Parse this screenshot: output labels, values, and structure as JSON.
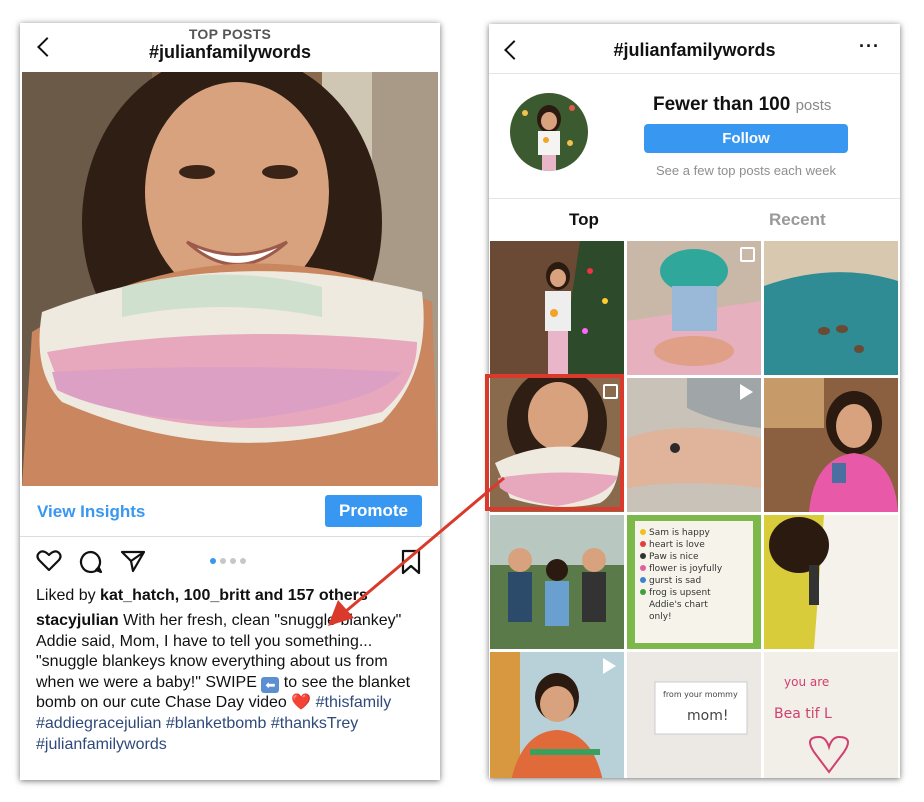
{
  "left": {
    "section_label": "TOP POSTS",
    "hashtag": "#julianfamilywords",
    "insights_label": "View Insights",
    "promote_label": "Promote",
    "likes_prefix": "Liked by",
    "liker1": "kat_hatch",
    "liker_sep": ",",
    "liker2": "100_britt",
    "likes_and": "and",
    "likes_count": "157 others",
    "caption_user": "stacyjulian",
    "caption_text1": "With her fresh, clean \"snuggle blankey\" Addie said, Mom, I have to tell you something... \"snuggle blankeys know everything about us from when we were a baby!\" SWIPE",
    "swipe_icon": "⬅",
    "caption_text2": "to see the blanket bomb on our cute Chase Day video",
    "heart_emoji": "❤️",
    "caption_tags": [
      "#thisfamily",
      "#addiegracejulian",
      "#blanketbomb",
      "#thanksTrey",
      "#julianfamilywords"
    ],
    "icons": [
      "back-chevron-icon",
      "heart-icon",
      "comment-icon",
      "share-icon",
      "bookmark-icon"
    ]
  },
  "right": {
    "hashtag": "#julianfamilywords",
    "more": "···",
    "count_main": "Fewer than 100",
    "count_suffix": "posts",
    "follow_label": "Follow",
    "subtext": "See a few top posts each week",
    "tabs": [
      "Top",
      "Recent"
    ],
    "active_tab": "Top",
    "note_lines": [
      "Sam is happy",
      "heart is love",
      "Paw is nice",
      "flower is joyfully",
      "gurst is sad",
      "frog is upsent",
      "Addie's chart",
      "only!"
    ],
    "card_lines": [
      "from your mommy",
      "mom!"
    ],
    "poster_lines": [
      "you are",
      "Bea tif L"
    ]
  },
  "colors": {
    "accent": "#3897f0",
    "annotation": "#d93a2b",
    "hashtag_link": "#2f4a7a"
  }
}
